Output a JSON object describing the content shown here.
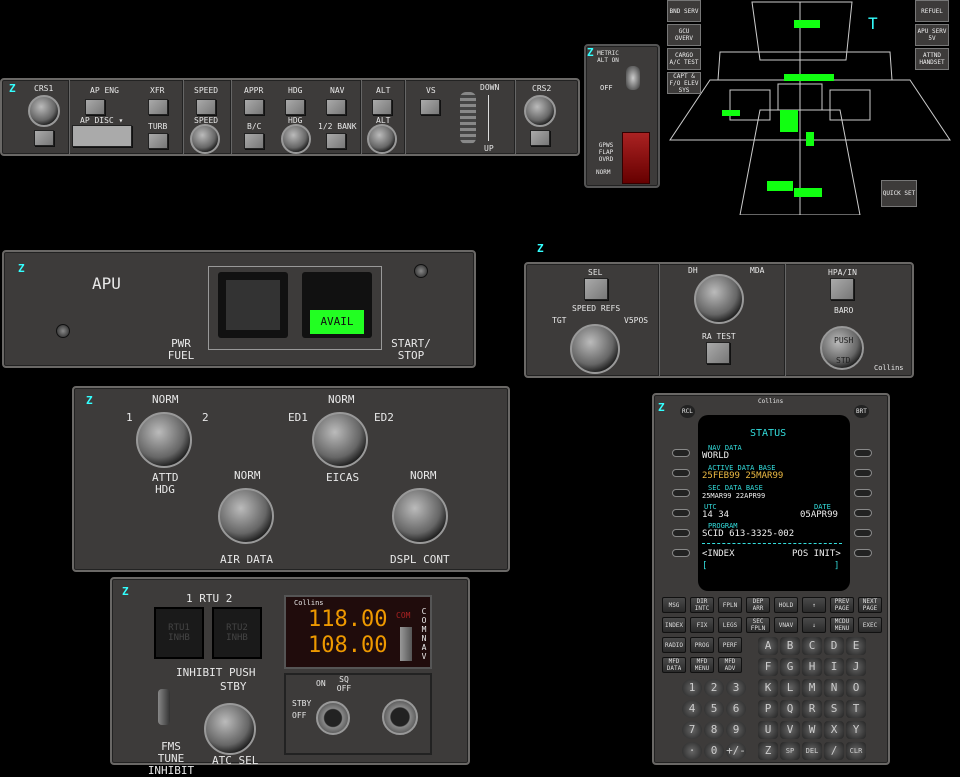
{
  "autopilot": {
    "z": "Z",
    "crs1": "CRS1",
    "ap_eng": "AP ENG",
    "xfr": "XFR",
    "ap_disc": "AP DISC ▾",
    "turb": "TURB",
    "speed": "SPEED",
    "speed_knob": "SPEED",
    "appr": "APPR",
    "hdg": "HDG",
    "nav": "NAV",
    "bc": "B/C",
    "hdg_knob": "HDG",
    "half_bank": "1/2 BANK",
    "alt": "ALT",
    "alt_knob": "ALT",
    "vs": "VS",
    "down": "DOWN",
    "up": "UP",
    "crs2": "CRS2"
  },
  "metric": {
    "z": "Z",
    "metric_on": "METRIC ALT ON",
    "off": "OFF",
    "gpws": "GPWS FLAP OVRD",
    "norm": "NORM"
  },
  "overview": {
    "left_buttons": [
      "BND SERV",
      "GCU OVERV",
      "CARGO A/C TEST",
      "CAPT & F/O ELEV SYS"
    ],
    "right_buttons": [
      "REFUEL",
      "APU SERV 5V",
      "ATTND HANDSET"
    ],
    "quick_set": "QUICK SET",
    "marker": "T"
  },
  "apu": {
    "z": "Z",
    "title": "APU",
    "pwr_fuel": "PWR FUEL",
    "avail": "AVAIL",
    "start_stop": "START/ STOP"
  },
  "refs": {
    "z": "Z",
    "sel": "SEL",
    "speed_refs": "SPEED REFS",
    "tgt": "TGT",
    "v5pos": "V5POS",
    "dh": "DH",
    "mda": "MDA",
    "ra_test": "RA TEST",
    "hpa_in": "HPA/IN",
    "baro": "BARO",
    "push": "PUSH",
    "std": "STD",
    "brand": "Collins"
  },
  "source": {
    "z": "Z",
    "norm1": "NORM",
    "one": "1",
    "two": "2",
    "attd_hdg": "ATTD HDG",
    "norm2": "NORM",
    "ed1": "ED1",
    "ed2": "ED2",
    "eicas": "EICAS",
    "norm3": "NORM",
    "air_data": "AIR DATA",
    "norm4": "NORM",
    "dspl_cont": "DSPL CONT"
  },
  "rtu": {
    "z": "Z",
    "title": "1 RTU 2",
    "rtu1": "RTU1 INHB",
    "rtu2": "RTU2 INHB",
    "inhibit_push": "INHIBIT PUSH",
    "fms_tune": "FMS TUNE INHIBIT",
    "stby": "STBY",
    "atc_sel": "ATC SEL",
    "brand": "Collins",
    "active_freq": "118.00",
    "standby_freq": "108.00",
    "com_ind": "COM",
    "com_nav": "COM NAV",
    "vol_stby": "STBY",
    "on": "ON",
    "sq_off": "SQ OFF",
    "off": "OFF"
  },
  "mcdu": {
    "brand": "Collins",
    "z": "Z",
    "rcl": "RCL",
    "brt": "BRT",
    "screen": {
      "title": "STATUS",
      "nav_data": "NAV DATA",
      "world": "WORLD",
      "active_db": "ACTIVE DATA BASE",
      "active_dates": "25FEB99 25MAR99",
      "sec_db": "SEC DATA BASE",
      "sec_dates": "25MAR99 22APR99",
      "utc": "UTC",
      "date": "DATE",
      "utc_val": "14 34",
      "date_val": "05APR99",
      "program": "PROGRAM",
      "program_val": "SCID 613-3325-002",
      "index": "<INDEX",
      "pos_init": "POS INIT>",
      "scratch_l": "[",
      "scratch_r": "]"
    },
    "func_keys": [
      "MSG",
      "DIR INTC",
      "FPLN",
      "DEP ARR",
      "HOLD",
      "↑",
      "PREV PAGE",
      "NEXT PAGE",
      "INDEX",
      "FIX",
      "LEGS",
      "SEC FPLN",
      "VNAV",
      "↓",
      "MCDU MENU",
      "EXEC",
      "RADIO",
      "PROG",
      "PERF",
      "MFD DATA",
      "MFD MENU",
      "MFD ADV"
    ],
    "alpha_keys": [
      "A",
      "B",
      "C",
      "D",
      "E",
      "F",
      "G",
      "H",
      "I",
      "J",
      "K",
      "L",
      "M",
      "N",
      "O",
      "P",
      "Q",
      "R",
      "S",
      "T",
      "U",
      "V",
      "W",
      "X",
      "Y",
      "Z",
      "SP",
      "DEL",
      "/",
      "CLR"
    ],
    "num_keys": [
      "1",
      "2",
      "3",
      "4",
      "5",
      "6",
      "7",
      "8",
      "9",
      "·",
      "0",
      "+/-"
    ]
  }
}
